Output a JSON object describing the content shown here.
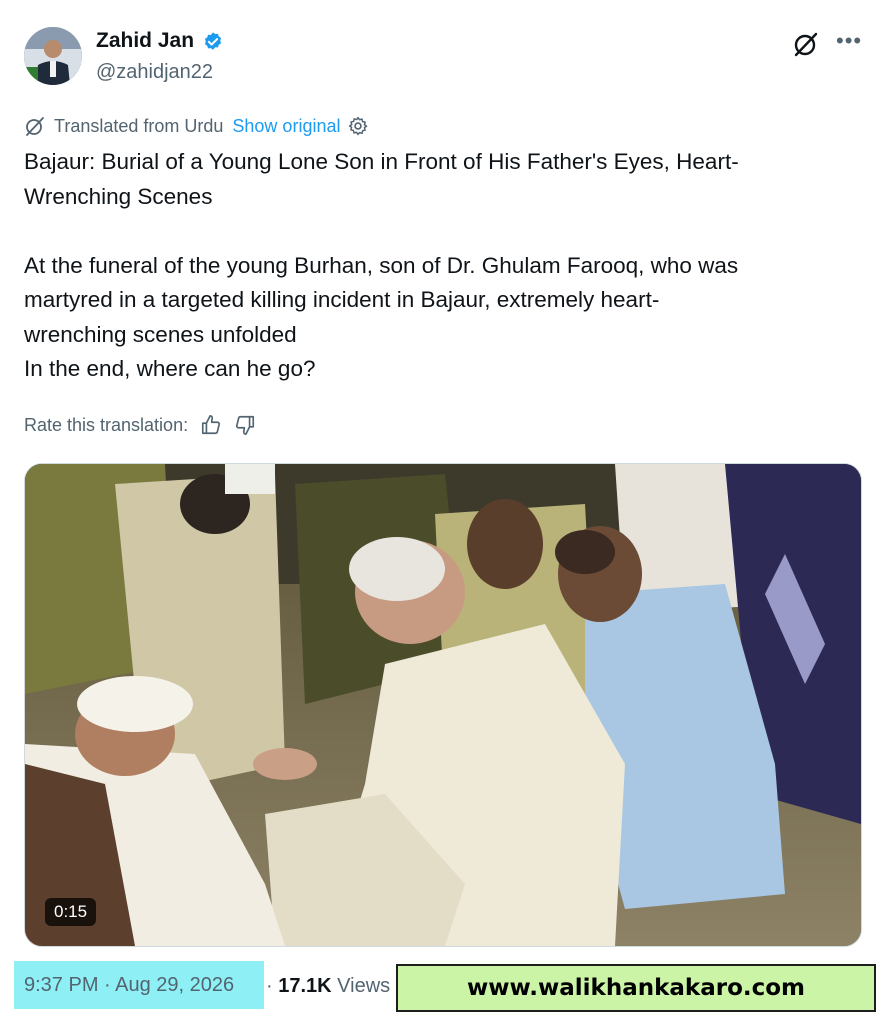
{
  "author": {
    "name": "Zahid Jan",
    "handle": "@zahidjan22"
  },
  "translation": {
    "label": "Translated from Urdu",
    "show_original": "Show original",
    "rate_label": "Rate this translation:"
  },
  "tweet": {
    "line1": "Bajaur: Burial of a Young Lone Son in Front of His Father's Eyes, Heart-",
    "line2": "Wrenching Scenes",
    "line3": "At the funeral of the young Burhan, son of Dr. Ghulam Farooq, who was",
    "line4": "martyred in a targeted killing incident in Bajaur, extremely heart-",
    "line5": "wrenching scenes unfolded",
    "line6": "In the end, where can he go?"
  },
  "media": {
    "duration": "0:15"
  },
  "footer": {
    "timestamp": "9:37 PM · Aug 29, 2026",
    "separator": "·",
    "views_count": "17.1K",
    "views_label": "Views"
  },
  "watermark": "www.walikhankakaro.com",
  "colors": {
    "accent": "#1d9bf0",
    "highlight": "#8ef0f5",
    "watermark_bg": "#cbf4a6"
  }
}
